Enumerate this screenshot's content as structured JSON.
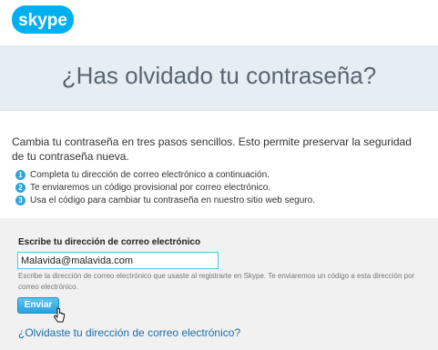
{
  "header": {
    "logo_text": "skype",
    "brand_color": "#00aff0"
  },
  "banner": {
    "title": "¿Has olvidado tu contraseña?"
  },
  "intro": {
    "text": "Cambia tu contraseña en tres pasos sencillos. Esto permite preservar la seguridad de tu contraseña nueva."
  },
  "steps": [
    {
      "num": "1",
      "text": "Completa tu dirección de correo electrónico a continuación."
    },
    {
      "num": "2",
      "text": "Te enviaremos un código provisional por correo electrónico."
    },
    {
      "num": "3",
      "text": "Usa el código para cambiar tu contraseña en nuestro sitio web seguro."
    }
  ],
  "form": {
    "label": "Escribe tu dirección de correo electrónico",
    "email_value": "Malavida@malavida.com",
    "help_text": "Escribe la dirección de correo electrónico que usaste al registrarte en Skype. Te enviaremos un código a esta dirección por correo electrónico.",
    "send_label": "Enviar",
    "forgot_link": "¿Olvidaste tu dirección de correo electrónico?"
  },
  "colors": {
    "banner_bg": "#e6eef4",
    "panel_bg": "#f1f1f1",
    "link": "#1a6fa8",
    "step_badge": "#2ea3d9"
  }
}
